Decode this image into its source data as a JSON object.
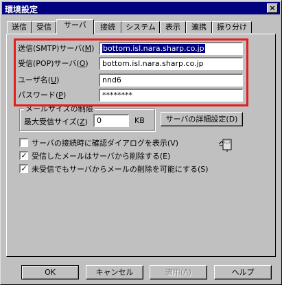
{
  "window": {
    "title": "環境設定",
    "close_label": "×"
  },
  "tabs": [
    "送信",
    "受信",
    "サーバ",
    "接続",
    "システム",
    "表示",
    "連携",
    "振り分け"
  ],
  "server": {
    "smtp_label": "送信(SMTP)サーバ(",
    "smtp_key": "M",
    "smtp_value": "bottom.isl.nara.sharp.co.jp",
    "pop_label": "受信(POP)サーバ(",
    "pop_key": "O",
    "pop_value": "bottom.isl.nara.sharp.co.jp",
    "user_label": "ユーザ名(",
    "user_key": "U",
    "user_value": "nnd6",
    "password_label": "パスワード(",
    "password_key": "P",
    "password_value": "********"
  },
  "mailsize": {
    "group_label": "メールサイズの制限",
    "max_label": "最大受信サイズ(",
    "max_key": "Z",
    "max_value": "0",
    "unit": "KB",
    "detail_button": "サーバの詳細設定(D)"
  },
  "options": [
    {
      "label": "サーバの接続時に確認ダイアログを表示(V)",
      "checked": false
    },
    {
      "label": "受信したメールはサーバから削除する(E)",
      "checked": true
    },
    {
      "label": "未受信でもサーバからメールの削除を可能にする(S)",
      "checked": true
    }
  ],
  "buttons": {
    "ok": "OK",
    "cancel": "キャンセル",
    "apply": "適用(A)",
    "help": "ヘルプ"
  },
  "close_paren": ")",
  "checkmark": "✓"
}
